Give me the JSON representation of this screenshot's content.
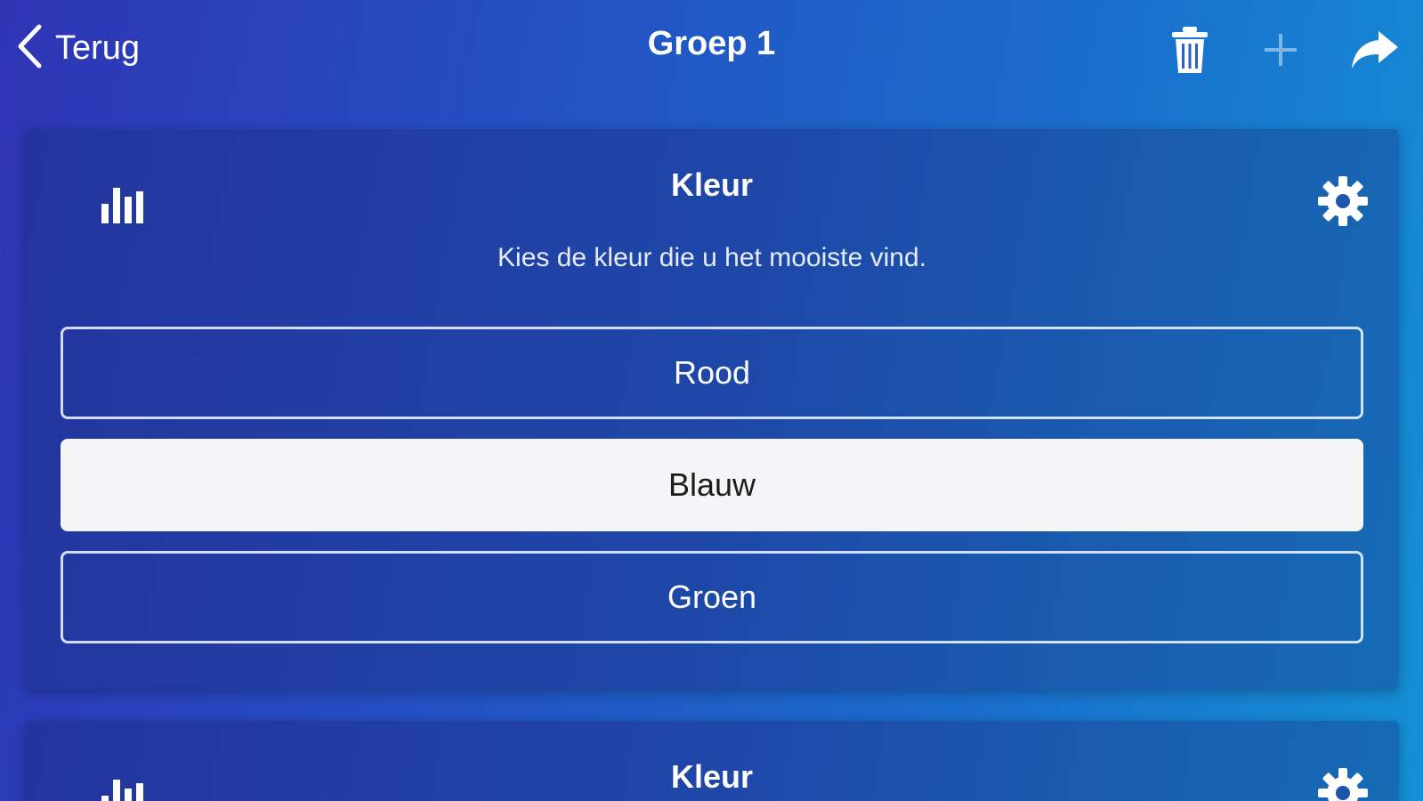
{
  "nav": {
    "back_label": "Terug",
    "title": "Groep 1",
    "icons": [
      "chevron-left-icon",
      "trash-icon",
      "plus-icon",
      "share-icon"
    ]
  },
  "questions": [
    {
      "title": "Kleur",
      "description": "Kies de kleur die u het mooiste vind.",
      "options": [
        {
          "label": "Rood",
          "selected": false
        },
        {
          "label": "Blauw",
          "selected": true
        },
        {
          "label": "Groen",
          "selected": false
        }
      ]
    },
    {
      "title": "Kleur"
    }
  ],
  "colors": {
    "background_start": "#2f34b5",
    "background_end": "#1490d6",
    "card": "#1e47a8",
    "selected_option_bg": "#f5f5f7",
    "selected_option_text": "#1c1c1c",
    "text": "#ffffff"
  }
}
